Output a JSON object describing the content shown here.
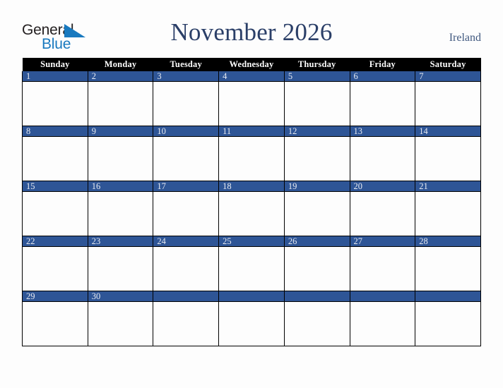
{
  "brand": {
    "name_part1": "General",
    "name_part2": "Blue",
    "triangle_icon": "blue-triangle-icon",
    "color_dark": "#231f20",
    "color_blue": "#1879bf"
  },
  "header": {
    "title": "November 2026",
    "month": "November",
    "year": "2026",
    "country": "Ireland",
    "title_color": "#2b3f68"
  },
  "calendar": {
    "accent_color": "#2e5596",
    "header_bg": "#000000",
    "header_text_color": "#ffffff",
    "cell_bg": "#fdfdfd",
    "border_color": "#000000",
    "day_number_color": "#e8ebf2",
    "day_names": [
      "Sunday",
      "Monday",
      "Tuesday",
      "Wednesday",
      "Thursday",
      "Friday",
      "Saturday"
    ],
    "weeks": [
      [
        "1",
        "2",
        "3",
        "4",
        "5",
        "6",
        "7"
      ],
      [
        "8",
        "9",
        "10",
        "11",
        "12",
        "13",
        "14"
      ],
      [
        "15",
        "16",
        "17",
        "18",
        "19",
        "20",
        "21"
      ],
      [
        "22",
        "23",
        "24",
        "25",
        "26",
        "27",
        "28"
      ],
      [
        "29",
        "30",
        "",
        "",
        "",
        "",
        ""
      ]
    ]
  }
}
